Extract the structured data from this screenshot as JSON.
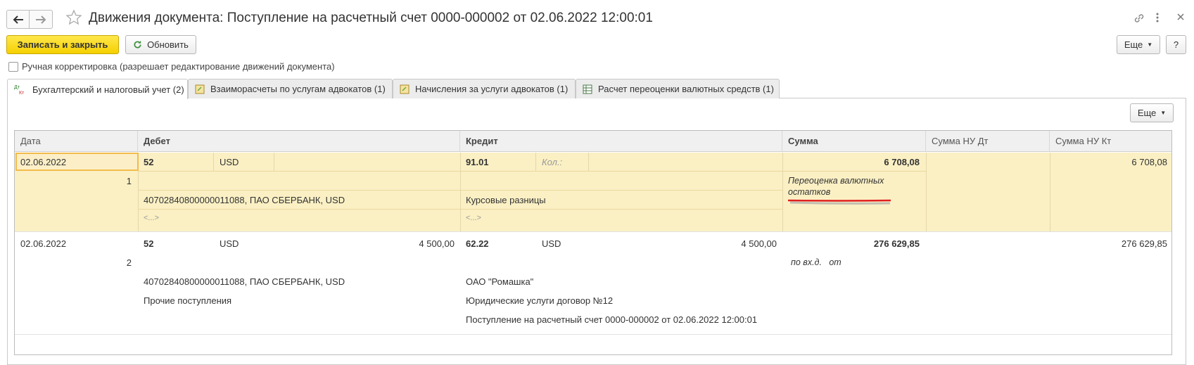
{
  "window": {
    "title": "Движения документа: Поступление на расчетный счет 0000-000002 от 02.06.2022 12:00:01"
  },
  "toolbar": {
    "save_close_label": "Записать и закрыть",
    "refresh_label": "Обновить",
    "more_label": "Еще",
    "help_label": "?"
  },
  "manual_correction": {
    "label": "Ручная корректировка (разрешает редактирование движений документа)",
    "checked": false
  },
  "tabs": [
    {
      "label": "Бухгалтерский и налоговый учет (2)"
    },
    {
      "label": "Взаиморасчеты по услугам адвокатов (1)"
    },
    {
      "label": "Начисления за услуги адвокатов (1)"
    },
    {
      "label": "Расчет переоценки валютных средств (1)"
    }
  ],
  "tab_icon_text": {
    "dt": "Дт",
    "kt": "Кт"
  },
  "table_more_label": "Еще",
  "table": {
    "columns": [
      "Дата",
      "Дебет",
      "Кредит",
      "Сумма",
      "Сумма НУ Дт",
      "Сумма НУ Кт"
    ],
    "rows": [
      {
        "date": "02.06.2022",
        "number": "1",
        "debit_account": "52",
        "debit_currency": "USD",
        "debit_subconto1": "40702840800000011088, ПАО СБЕРБАНК, USD",
        "debit_subconto2": "<...>",
        "credit_account": "91.01",
        "credit_qty_label": "Кол.:",
        "credit_subconto1": "Курсовые разницы",
        "credit_subconto2": "<...>",
        "amount": "6 708,08",
        "content": "Переоценка валютных остатков",
        "nu_dt": "",
        "nu_kt": "6 708,08"
      },
      {
        "date": "02.06.2022",
        "number": "2",
        "debit_account": "52",
        "debit_currency": "USD",
        "debit_currency_amount": "4 500,00",
        "debit_subconto1": "40702840800000011088, ПАО СБЕРБАНК, USD",
        "debit_subconto2": "Прочие поступления",
        "credit_account": "62.22",
        "credit_currency": "USD",
        "credit_currency_amount": "4 500,00",
        "credit_subconto1": "ОАО \"Ромашка\"",
        "credit_subconto2": "Юридические услуги договор №12",
        "credit_subconto3": "Поступление на расчетный счет 0000-000002 от 02.06.2022 12:00:01",
        "amount": "276 629,85",
        "incoming_doc_label": "по вх.д.",
        "incoming_doc_from": "от",
        "nu_dt": "",
        "nu_kt": "276 629,85"
      }
    ]
  }
}
